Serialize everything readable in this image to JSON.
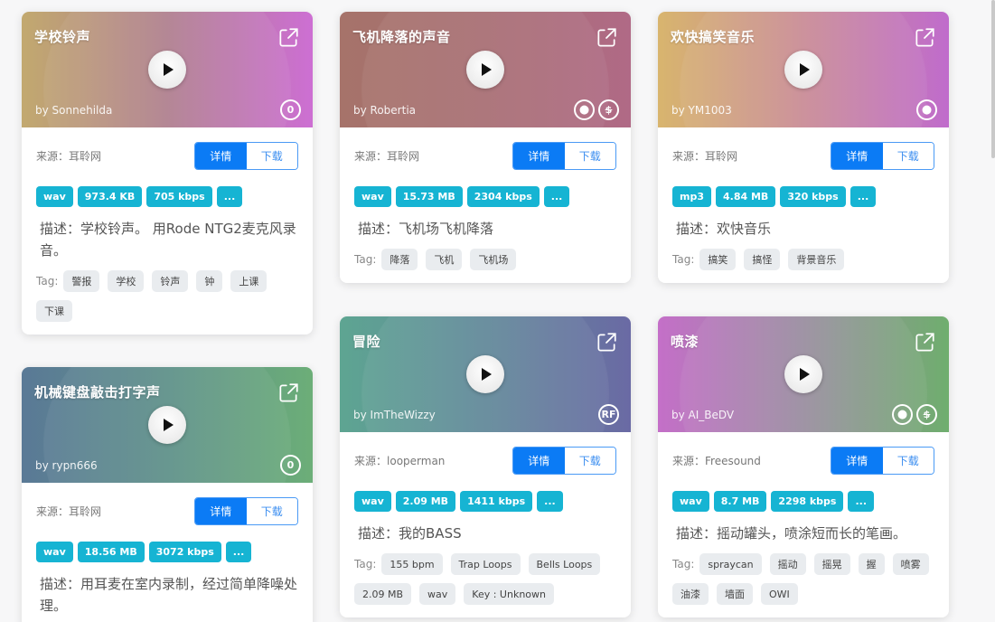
{
  "labels": {
    "source_prefix": "来源：",
    "detail": "详情",
    "download": "下载",
    "desc_prefix": "描述：",
    "tag_label": "Tag:",
    "more": "..."
  },
  "colors": {
    "primary": "#0b7bf5",
    "badge": "#16b4d3",
    "tag_bg": "#e9ecef"
  },
  "cards": [
    {
      "title": "学校铃声",
      "author": "by Sonnehilda",
      "licenses": [
        "cc-zero-icon"
      ],
      "source": "耳聆网",
      "format": "wav",
      "size": "973.4 KB",
      "bitrate": "705 kbps",
      "description": "学校铃声。 用Rode NTG2麦克风录音。",
      "tags": [
        "警报",
        "学校",
        "铃声",
        "钟",
        "上课",
        "下课"
      ],
      "gradient": [
        "#c2a96f",
        "#b0808f",
        "#cd6fd3"
      ]
    },
    {
      "title": "飞机降落的声音",
      "author": "by Robertia",
      "licenses": [
        "cc-by-icon",
        "cc-nc-icon"
      ],
      "source": "耳聆网",
      "format": "wav",
      "size": "15.73 MB",
      "bitrate": "2304 kbps",
      "description": "飞机场飞机降落",
      "tags": [
        "降落",
        "飞机",
        "飞机场"
      ],
      "gradient": [
        "#a6736a",
        "#a86f74",
        "#b06a86"
      ]
    },
    {
      "title": "欢快搞笑音乐",
      "author": "by YM1003",
      "licenses": [
        "cc-by-icon"
      ],
      "source": "耳聆网",
      "format": "mp3",
      "size": "4.84 MB",
      "bitrate": "320 kbps",
      "description": "欢快音乐",
      "tags": [
        "搞笑",
        "搞怪",
        "背景音乐"
      ],
      "gradient": [
        "#d8b56e",
        "#c98c96",
        "#c06ccc"
      ]
    },
    {
      "title": "机械键盘敲击打字声",
      "author": "by rypn666",
      "licenses": [
        "cc-zero-icon"
      ],
      "source": "耳聆网",
      "format": "wav",
      "size": "18.56 MB",
      "bitrate": "3072 kbps",
      "description": "用耳麦在室内录制，经过简单降噪处理。",
      "tags": [],
      "gradient": [
        "#5a7996",
        "#5f918a",
        "#6cae78"
      ]
    },
    {
      "title": "冒险",
      "author": "by ImTheWizzy",
      "licenses": [
        "royalty-free-icon"
      ],
      "source": "looperman",
      "format": "wav",
      "size": "2.09 MB",
      "bitrate": "1411 kbps",
      "description": "我的BASS",
      "tags": [
        "155 bpm",
        "Trap Loops",
        "Bells Loops",
        "2.09 MB",
        "wav",
        "Key : Unknown"
      ],
      "gradient": [
        "#5ea592",
        "#62899a",
        "#6a6aa4"
      ]
    },
    {
      "title": "喷漆",
      "author": "by AI_BeDV",
      "licenses": [
        "cc-by-icon",
        "cc-nc-icon"
      ],
      "source": "Freesound",
      "format": "wav",
      "size": "8.7 MB",
      "bitrate": "2298 kbps",
      "description": "摇动罐头，喷涂短而长的笔画。",
      "tags": [
        "spraycan",
        "摇动",
        "摇晃",
        "握",
        "喷雾",
        "油漆",
        "墙面",
        "OWI"
      ],
      "gradient": [
        "#c46fc8",
        "#9a8ea0",
        "#6fae6e"
      ]
    }
  ]
}
